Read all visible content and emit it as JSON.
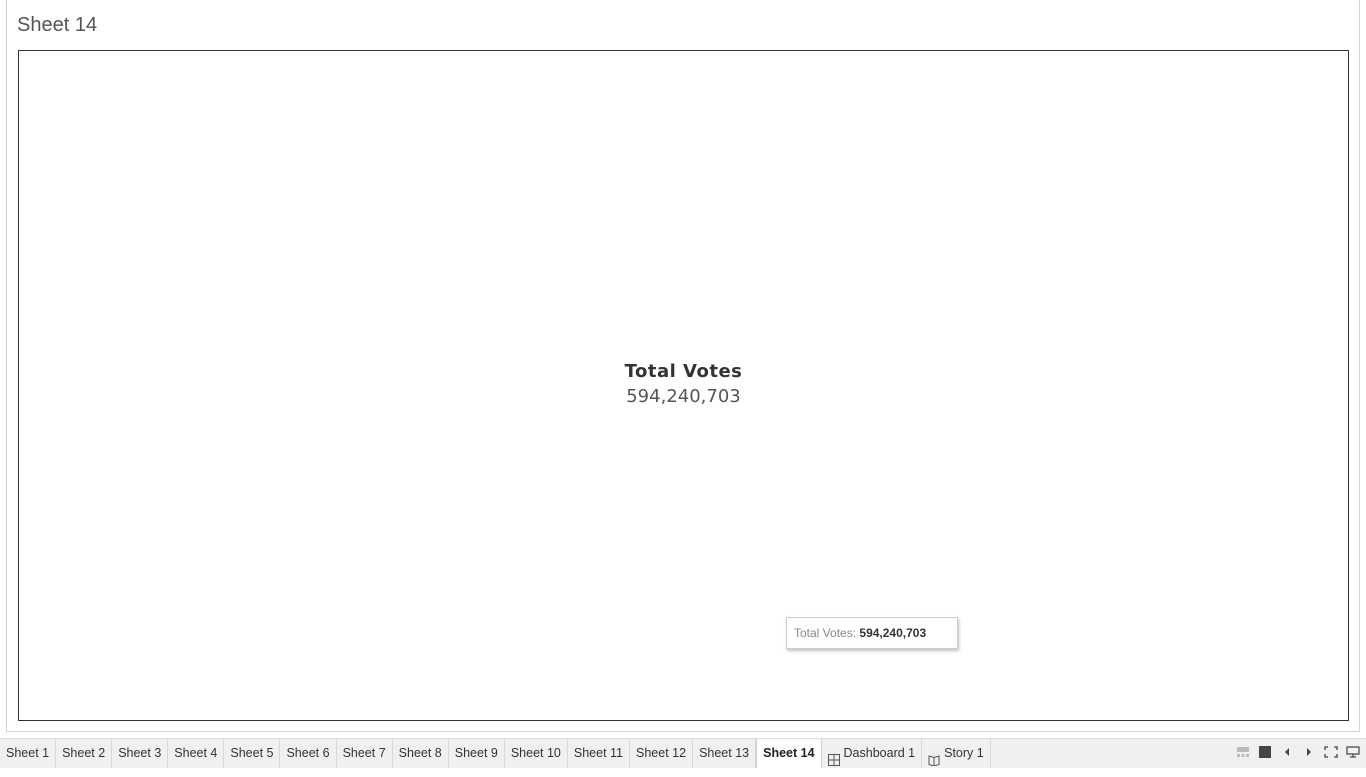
{
  "sheet": {
    "title": "Sheet 14"
  },
  "kpi": {
    "label": "Total Votes",
    "value": "594,240,703"
  },
  "tooltip": {
    "key": "Total Votes:",
    "value": "594,240,703"
  },
  "tabs": [
    {
      "label": "Sheet 1"
    },
    {
      "label": "Sheet 2"
    },
    {
      "label": "Sheet 3"
    },
    {
      "label": "Sheet 4"
    },
    {
      "label": "Sheet 5"
    },
    {
      "label": "Sheet 6"
    },
    {
      "label": "Sheet 7"
    },
    {
      "label": "Sheet 8"
    },
    {
      "label": "Sheet 9"
    },
    {
      "label": "Sheet 10"
    },
    {
      "label": "Sheet 11"
    },
    {
      "label": "Sheet 12"
    },
    {
      "label": "Sheet 13"
    },
    {
      "label": "Sheet 14",
      "active": true
    },
    {
      "label": "Dashboard 1",
      "icon": "dashboard-icon"
    },
    {
      "label": "Story 1",
      "icon": "story-icon"
    }
  ],
  "controls": [
    "show-filmstrip-icon",
    "show-tabs-icon",
    "previous-sheet-icon",
    "next-sheet-icon",
    "presentation-mode-icon",
    "device-preview-icon"
  ]
}
